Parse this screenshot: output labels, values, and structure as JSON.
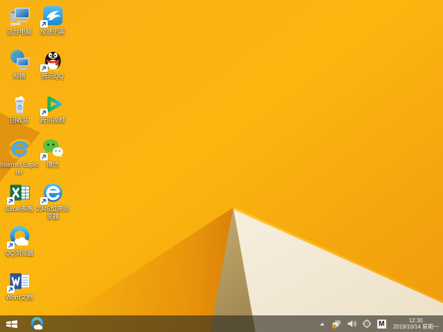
{
  "desktop": {
    "icons": [
      {
        "label": "这台电脑",
        "name": "this-pc",
        "shortcut": false
      },
      {
        "label": "极速迅雷",
        "name": "xunlei",
        "shortcut": true
      },
      {
        "label": "网络",
        "name": "network",
        "shortcut": false
      },
      {
        "label": "腾讯QQ",
        "name": "tencent-qq",
        "shortcut": true
      },
      {
        "label": "回收站",
        "name": "recycle-bin",
        "shortcut": false
      },
      {
        "label": "腾讯视频",
        "name": "tencent-video",
        "shortcut": true
      },
      {
        "label": "Internet Explorer",
        "name": "internet-explorer",
        "shortcut": false
      },
      {
        "label": "微信",
        "name": "wechat",
        "shortcut": true
      },
      {
        "label": "Excel表格",
        "name": "excel",
        "shortcut": true
      },
      {
        "label": "2345加速浏览器",
        "name": "browser-2345",
        "shortcut": true
      },
      {
        "label": "QQ浏览器",
        "name": "qq-browser",
        "shortcut": true
      },
      {
        "label": "Word文档",
        "name": "word",
        "shortcut": true
      }
    ]
  },
  "taskbar": {
    "tray": {
      "time": "12:30",
      "date": "2019/10/14 星期一",
      "ime_indicator": "M"
    }
  },
  "wallpaper": {
    "base_orange": "#FAB111",
    "deep_orange": "#EF9A0C",
    "fold_shadow": "#DE820A",
    "left_wedge": "#E2930F",
    "tan_triangle": "#B19C66",
    "cream_triangle": "#F3E9D7",
    "bright_edge": "#FFC41F"
  }
}
